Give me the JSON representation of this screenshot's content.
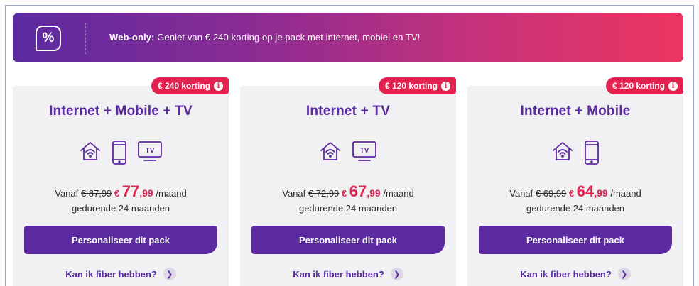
{
  "banner": {
    "icon": "percent-icon",
    "prefix": "Web-only:",
    "text": " Geniet van € 240 korting op je pack met internet, mobiel en TV!"
  },
  "colors": {
    "purple": "#5b2aa0",
    "red": "#e3234f",
    "gradient_start": "#5b2aa0",
    "gradient_end": "#ec3560"
  },
  "cards": [
    {
      "badge": "€ 240 korting",
      "title": "Internet + Mobile + TV",
      "icons": [
        "wifi-house-icon",
        "phone-icon",
        "tv-icon"
      ],
      "from_label": "Vanaf",
      "old_price": "€ 87,99",
      "currency": "€",
      "price_euros": "77",
      "price_cents": ",99",
      "per": "/maand",
      "duration": "gedurende 24 maanden",
      "cta": "Personaliseer dit pack",
      "fiber_link": "Kan ik fiber hebben?"
    },
    {
      "badge": "€ 120 korting",
      "title": "Internet + TV",
      "icons": [
        "wifi-house-icon",
        "tv-icon"
      ],
      "from_label": "Vanaf",
      "old_price": "€ 72,99",
      "currency": "€",
      "price_euros": "67",
      "price_cents": ",99",
      "per": "/maand",
      "duration": "gedurende 24 maanden",
      "cta": "Personaliseer dit pack",
      "fiber_link": "Kan ik fiber hebben?"
    },
    {
      "badge": "€ 120 korting",
      "title": "Internet + Mobile",
      "icons": [
        "wifi-house-icon",
        "phone-icon"
      ],
      "from_label": "Vanaf",
      "old_price": "€ 69,99",
      "currency": "€",
      "price_euros": "64",
      "price_cents": ",99",
      "per": "/maand",
      "duration": "gedurende 24 maanden",
      "cta": "Personaliseer dit pack",
      "fiber_link": "Kan ik fiber hebben?"
    }
  ],
  "tv_icon_label": "TV"
}
